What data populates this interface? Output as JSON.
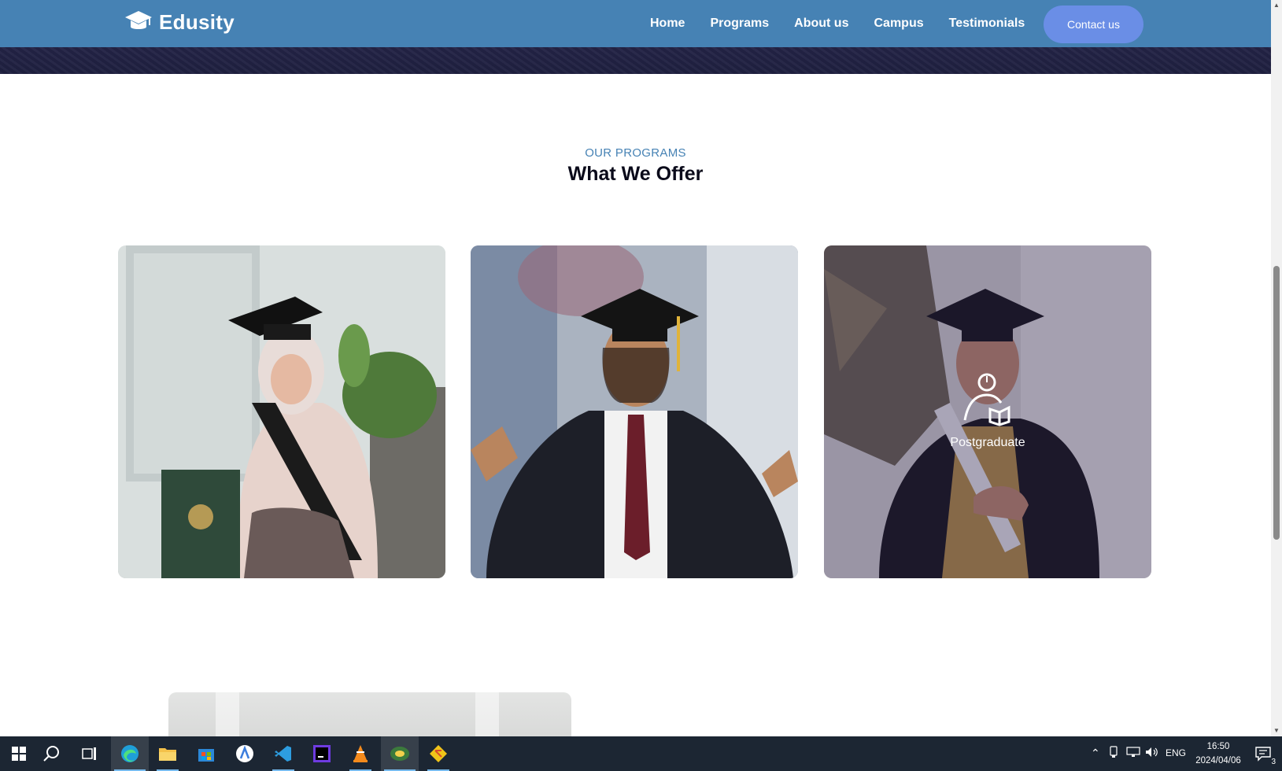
{
  "brand": {
    "name": "Edusity",
    "icon": "graduation-cap-icon"
  },
  "nav": {
    "links": [
      "Home",
      "Programs",
      "About us",
      "Campus",
      "Testimonials"
    ],
    "contact_label": "Contact us"
  },
  "section": {
    "subtitle": "OUR PROGRAMS",
    "title": "What We Offer"
  },
  "programs": [
    {
      "caption": "",
      "icon": ""
    },
    {
      "caption": "",
      "icon": ""
    },
    {
      "caption": "Postgraduate",
      "icon": "postgraduate-reader-icon"
    }
  ],
  "taskbar": {
    "apps": [
      "start-icon",
      "search-icon",
      "task-view-icon",
      "edge-icon",
      "file-explorer-icon",
      "store-icon",
      "android-studio-icon",
      "vscode-icon",
      "intellij-icon",
      "vlc-icon",
      "network-tool-icon",
      "git-icon"
    ],
    "language": "ENG",
    "time": "16:50",
    "date": "2024/04/06",
    "notification_count": "3"
  },
  "colors": {
    "navbar": "#4682b4",
    "contact_button": "#6a8ee6",
    "subtitle": "#4682b4",
    "title": "#0a0a1a",
    "taskbar": "#1c2633"
  }
}
